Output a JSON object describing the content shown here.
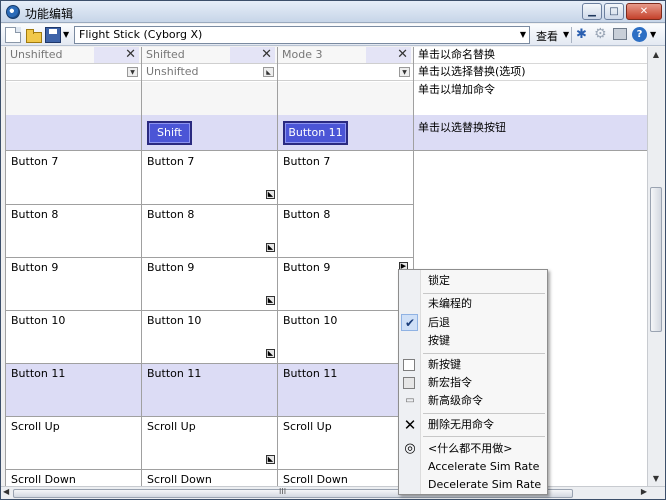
{
  "window": {
    "title": "功能编辑"
  },
  "toolbar": {
    "profile_value": "Flight Stick (Cyborg X)",
    "view_label": "查看",
    "help_glyph": "?"
  },
  "grid": {
    "headers": [
      {
        "label": "Unshifted",
        "close": "✕"
      },
      {
        "label": "Shifted",
        "close": "✕"
      },
      {
        "label": "Mode 3",
        "close": "✕"
      }
    ],
    "unshift_value": "Unshifted",
    "shift_button": "Shift",
    "mode_button": "Button 11",
    "right_panel": {
      "rename_hint": "单击以命名替换",
      "select_hint": "单击以选择替换(选项)",
      "add_hint": "单击以增加命令",
      "toggle_hint": "单击以选替换按钮"
    },
    "rows": [
      {
        "c1": "Button 7",
        "c2": "Button 7",
        "c3": "Button 7"
      },
      {
        "c1": "Button 8",
        "c2": "Button 8",
        "c3": "Button 8"
      },
      {
        "c1": "Button 9",
        "c2": "Button 9",
        "c3": "Button 9"
      },
      {
        "c1": "Button 10",
        "c2": "Button 10",
        "c3": "Button 10"
      },
      {
        "c1": "Button 11",
        "c2": "Button 11",
        "c3": "Button 11"
      },
      {
        "c1": "Scroll Up",
        "c2": "Scroll Up",
        "c3": "Scroll Up"
      },
      {
        "c1": "Scroll Down",
        "c2": "Scroll Down",
        "c3": "Scroll Down"
      }
    ],
    "scroll_grip": "III"
  },
  "context_menu": {
    "items": {
      "lock": "锁定",
      "unprogrammed": "未编程的",
      "back": "后退",
      "key": "按键",
      "new_key": "新按键",
      "new_macro": "新宏指令",
      "new_advanced": "新高级命令",
      "delete_useless": "删除无用命令",
      "do_nothing": "<什么都不用做>",
      "accel": "Accelerate Sim Rate",
      "decel": "Decelerate Sim Rate"
    }
  }
}
